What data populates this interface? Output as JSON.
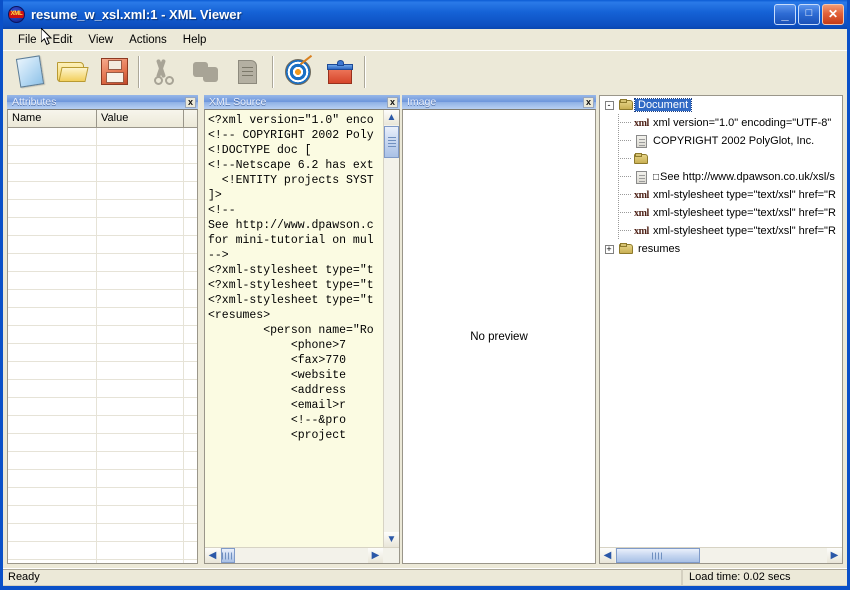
{
  "window": {
    "title": "resume_w_xsl.xml:1 - XML Viewer",
    "icon": "xml-badge-icon",
    "minimize_label": "_",
    "maximize_label": "□",
    "close_label": "✕"
  },
  "menubar": {
    "items": [
      {
        "label": "File"
      },
      {
        "label": "Edit"
      },
      {
        "label": "View"
      },
      {
        "label": "Actions"
      },
      {
        "label": "Help"
      }
    ]
  },
  "toolbar": {
    "buttons": [
      {
        "name": "new-document-button",
        "icon": "new-document-icon",
        "enabled": true
      },
      {
        "name": "open-file-button",
        "icon": "open-folder-icon",
        "enabled": true
      },
      {
        "name": "save-file-button",
        "icon": "floppy-disk-icon",
        "enabled": true
      },
      {
        "name": "cut-button",
        "icon": "scissors-icon",
        "enabled": false
      },
      {
        "name": "copy-button",
        "icon": "copy-icon",
        "enabled": false
      },
      {
        "name": "paste-button",
        "icon": "clipboard-icon",
        "enabled": false
      },
      {
        "name": "find-button",
        "icon": "target-icon",
        "enabled": true
      },
      {
        "name": "extras-button",
        "icon": "gift-box-icon",
        "enabled": true
      }
    ]
  },
  "panes": {
    "attributes": {
      "title": "Attributes",
      "close_label": "x",
      "columns": [
        "Name",
        "Value",
        ""
      ],
      "rows": []
    },
    "xml_source": {
      "title": "XML Source",
      "close_label": "x",
      "text": "<?xml version=\"1.0\" enco\n<!-- COPYRIGHT 2002 Poly\n<!DOCTYPE doc [\n<!--Netscape 6.2 has ext\n  <!ENTITY projects SYST\n]>\n<!--\nSee http://www.dpawson.c\nfor mini-tutorial on mul\n-->\n<?xml-stylesheet type=\"t\n<?xml-stylesheet type=\"t\n<?xml-stylesheet type=\"t\n<resumes>\n        <person name=\"Ro\n            <phone>7\n            <fax>770\n            <website\n            <address\n            <email>r\n            <!--&pro\n            <project"
    },
    "image": {
      "title": "Image",
      "close_label": "x",
      "empty_message": "No preview"
    },
    "tree": {
      "nodes": [
        {
          "indent": 0,
          "expander": "-",
          "icon": "folder-icon",
          "label": "Document",
          "selected": true
        },
        {
          "indent": 1,
          "expander": "",
          "icon": "xml-icon",
          "label": "xml version=\"1.0\" encoding=\"UTF-8\"",
          "selected": false
        },
        {
          "indent": 1,
          "expander": "",
          "icon": "comment-page-icon",
          "label": " COPYRIGHT 2002 PolyGlot, Inc.",
          "selected": false
        },
        {
          "indent": 1,
          "expander": "",
          "icon": "folder-icon",
          "label": "",
          "selected": false
        },
        {
          "indent": 1,
          "expander": "",
          "icon": "comment-page-icon",
          "label": "See http://www.dpawson.co.uk/xsl/s",
          "selected": false,
          "box_prefix": true
        },
        {
          "indent": 1,
          "expander": "",
          "icon": "xml-icon",
          "label": "xml-stylesheet type=\"text/xsl\" href=\"R",
          "selected": false
        },
        {
          "indent": 1,
          "expander": "",
          "icon": "xml-icon",
          "label": "xml-stylesheet type=\"text/xsl\" href=\"R",
          "selected": false
        },
        {
          "indent": 1,
          "expander": "",
          "icon": "xml-icon",
          "label": "xml-stylesheet type=\"text/xsl\" href=\"R",
          "selected": false
        },
        {
          "indent": 0,
          "expander": "+",
          "icon": "folder-icon",
          "label": "resumes",
          "selected": false
        }
      ]
    }
  },
  "scrollbars": {
    "up_arrow": "▲",
    "down_arrow": "▼",
    "left_arrow": "◀",
    "right_arrow": "▶"
  },
  "statusbar": {
    "message": "Ready",
    "load_time": "Load time: 0.02 secs"
  }
}
